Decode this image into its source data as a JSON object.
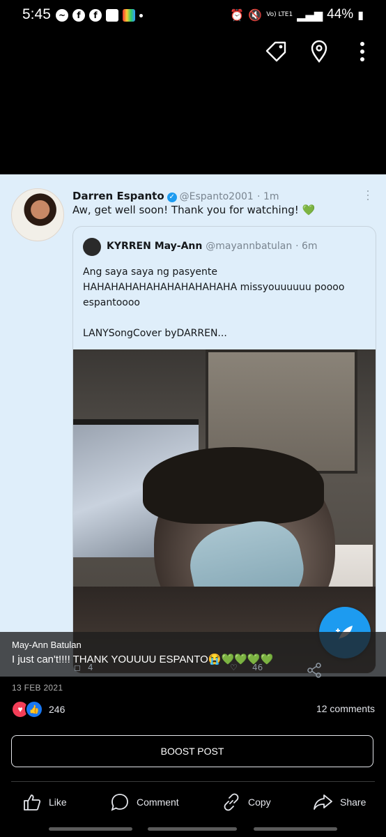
{
  "status_bar": {
    "time": "5:45",
    "battery": "44%",
    "network": "Vo) LTE1"
  },
  "tweet": {
    "author_name": "Darren Espanto",
    "handle": "@Espanto2001",
    "age": "· 1m",
    "text": "Aw, get well soon! Thank you for watching! ",
    "text_emoji": "💚",
    "quote": {
      "name": "KYRREN May-Ann",
      "handle": "@mayannbatulan",
      "age": "· 6m",
      "text": "Ang saya saya ng pasyente\nHAHAHAHAHAHAHAHAHAHAHA missyouuuuuu poooo\nespantoooo\n\nLANYSongCover byDARREN..."
    },
    "ghost_reply_count": "4",
    "ghost_like_count": "46"
  },
  "post": {
    "author": "May-Ann Batulan",
    "caption": "I just can't!!!! THANK YOUUUU ESPANTO😭💚💚💚💚",
    "date": "13 FEB 2021",
    "reactions_count": "246",
    "comments_label": "12 comments",
    "boost_label": "BOOST POST"
  },
  "actions": {
    "like": "Like",
    "comment": "Comment",
    "copy": "Copy",
    "share": "Share"
  },
  "colors": {
    "tweet_bg": "#dfeefa",
    "twitter_blue": "#1d9bf0",
    "fb_blue": "#1877f2",
    "fb_red": "#f33e58"
  },
  "icons": [
    "messenger-icon",
    "facebook-icon",
    "facebook-icon",
    "shopping-icon",
    "app-icon",
    "alarm-icon",
    "mute-icon",
    "wifi-icon",
    "signal-icon",
    "battery-icon",
    "tag-icon",
    "location-icon",
    "more-vertical-icon",
    "verified-icon",
    "compose-icon",
    "like-icon",
    "comment-icon",
    "copy-link-icon",
    "share-icon"
  ]
}
